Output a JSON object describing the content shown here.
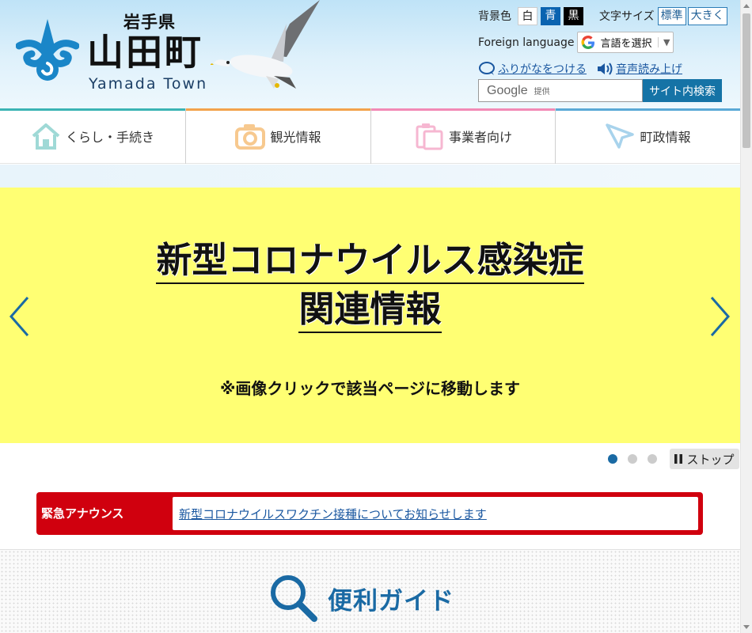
{
  "header": {
    "prefecture": "岩手県",
    "town_jp": "山田町",
    "town_en": "Yamada Town"
  },
  "tools": {
    "bg_label": "背景色",
    "bg_white": "白",
    "bg_blue": "青",
    "bg_black": "黒",
    "size_label": "文字サイズ",
    "size_standard": "標準",
    "size_large": "大きく",
    "foreign_label": "Foreign language",
    "translate_label": "言語を選択",
    "translate_caret": "▼",
    "furigana": "ふりがなをつける",
    "read_aloud": "音声読み上げ"
  },
  "search": {
    "google": "Google",
    "provided": "提供",
    "button": "サイト内検索"
  },
  "nav": {
    "items": [
      {
        "label": "くらし・手続き",
        "icon": "house-icon",
        "color": "#3cb4b4"
      },
      {
        "label": "観光情報",
        "icon": "camera-icon",
        "color": "#f3a34c"
      },
      {
        "label": "事業者向け",
        "icon": "clipboard-icon",
        "color": "#f28ab6"
      },
      {
        "label": "町政情報",
        "icon": "flag-icon",
        "color": "#5aa9d6"
      }
    ]
  },
  "slider": {
    "title_line1": "新型コロナウイルス感染症",
    "title_line2": "関連情報",
    "note": "※画像クリックで該当ページに移動します",
    "stop_label": "ストップ",
    "background": "#ffff73",
    "slide_count": 3,
    "active_slide": 1
  },
  "emergency": {
    "label": "緊急アナウンス",
    "link": "新型コロナウイルスワクチン接種についてお知らせします",
    "color": "#d0000e"
  },
  "guide": {
    "title": "便利ガイド",
    "icon": "magnifier-icon"
  },
  "colors": {
    "accent": "#1a6aa4",
    "link": "#1a57a0"
  }
}
